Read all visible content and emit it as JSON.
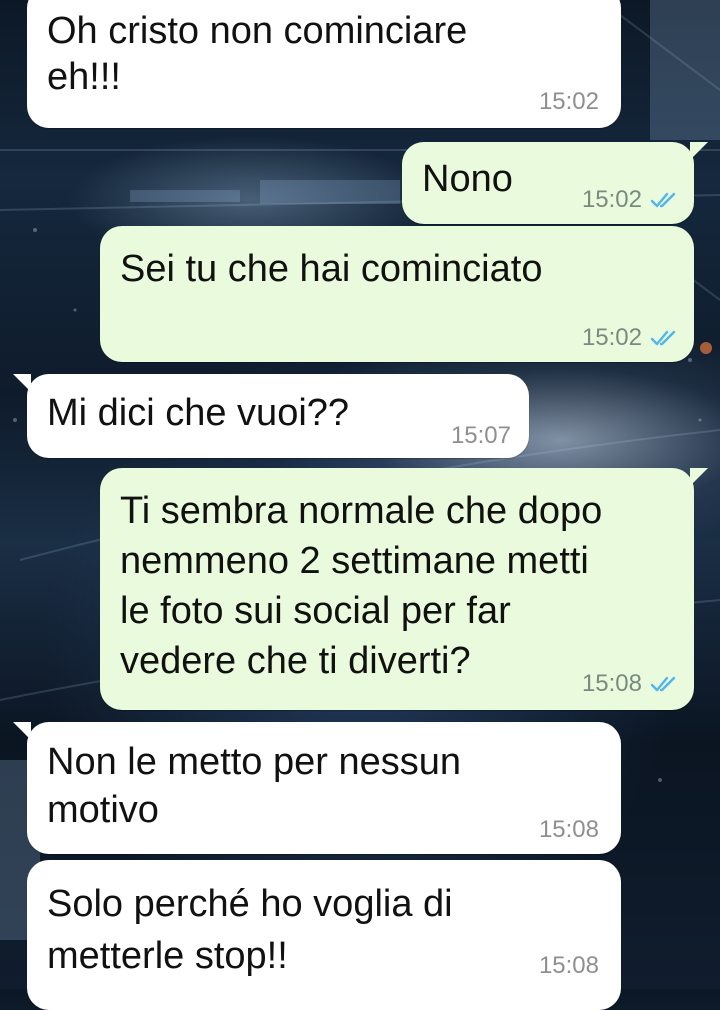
{
  "colors": {
    "incoming_bubble": "#ffffff",
    "outgoing_bubble": "#e9fbdc",
    "read_ticks": "#4fb6ec",
    "timestamp": "#8d8f91"
  },
  "messages": [
    {
      "direction": "in",
      "text": "Oh cristo non cominciare\neh!!!",
      "time": "15:02"
    },
    {
      "direction": "out",
      "text": "Nono",
      "time": "15:02",
      "status_icon": "double-check-read-icon"
    },
    {
      "direction": "out",
      "text": "Sei tu che hai cominciato",
      "time": "15:02",
      "status_icon": "double-check-read-icon"
    },
    {
      "direction": "in",
      "text": "Mi dici che vuoi??",
      "time": "15:07"
    },
    {
      "direction": "out",
      "text": "Ti sembra normale che dopo\nnemmeno 2 settimane metti\nle foto sui social per far\nvedere che ti diverti?",
      "time": "15:08",
      "status_icon": "double-check-read-icon"
    },
    {
      "direction": "in",
      "text": "Non le metto per nessun\nmotivo",
      "time": "15:08"
    },
    {
      "direction": "in",
      "text": "Solo perché ho voglia di\nmetterle stop!!",
      "time": "15:08"
    }
  ]
}
